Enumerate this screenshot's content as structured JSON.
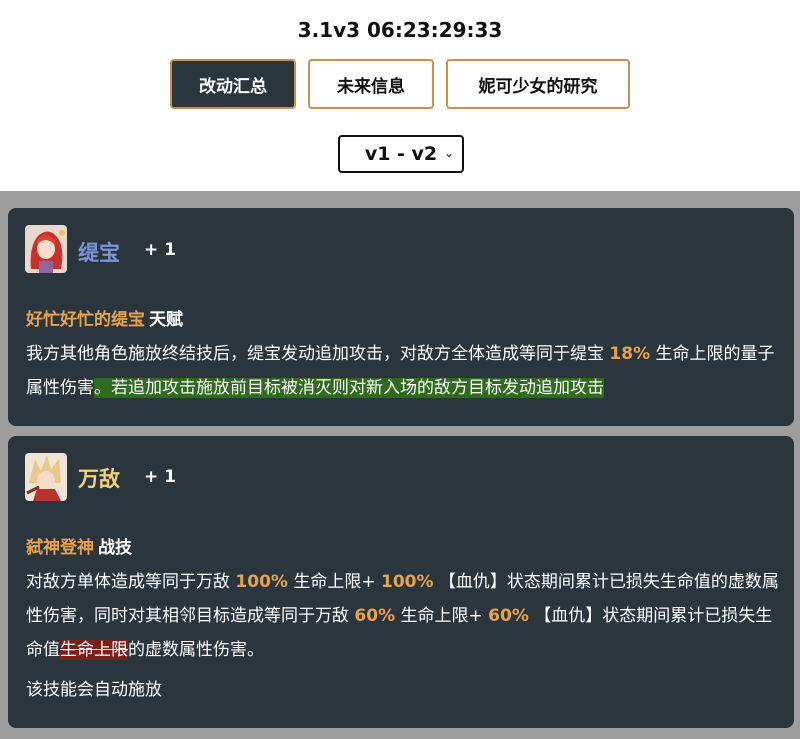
{
  "header": {
    "title": "3.1v3 06:23:29:33",
    "tabs": [
      {
        "label": "改动汇总",
        "active": true
      },
      {
        "label": "未来信息",
        "active": false
      },
      {
        "label": "妮可少女的研究",
        "active": false
      }
    ],
    "version_select": {
      "value": "v1 - v2"
    }
  },
  "colors": {
    "card_bg": "#2a353d",
    "accent": "#c8914d",
    "highlight": "#e6a24c",
    "added_bg": "#2e6b1f",
    "removed_bg": "#7a1f1a",
    "page_bg": "#9e9e9e"
  },
  "cards": [
    {
      "name": "缇宝",
      "count": "+ 1",
      "skill_name": "好忙好忙的缇宝",
      "skill_type": "天赋",
      "desc": {
        "t1": "我方其他角色施放终结技后，缇宝发动追加攻击，对敌方全体造成等同于缇宝 ",
        "v1": "18%",
        "t2": " 生命上限的量子属性伤害",
        "added": "。若追加攻击施放前目标被消灭则对新入场的敌方目标发动追加攻击"
      }
    },
    {
      "name": "万敌",
      "count": "+ 1",
      "skill_name": "弑神登神",
      "skill_type": "战技",
      "desc": {
        "t1": "对敌方单体造成等同于万敌 ",
        "v1": "100%",
        "t2": " 生命上限+ ",
        "v2": "100%",
        "t3": " 【血仇】状态期间累计已损失生命值的虚数属性伤害，同时对其相邻目标造成等同于万敌 ",
        "v3": "60%",
        "t4": " 生命上限+ ",
        "v4": "60%",
        "t5": " 【血仇】状态期间累计已损失生命值",
        "removed": "生命上限",
        "t6": "的虚数属性伤害。"
      },
      "note": "该技能会自动施放"
    }
  ]
}
